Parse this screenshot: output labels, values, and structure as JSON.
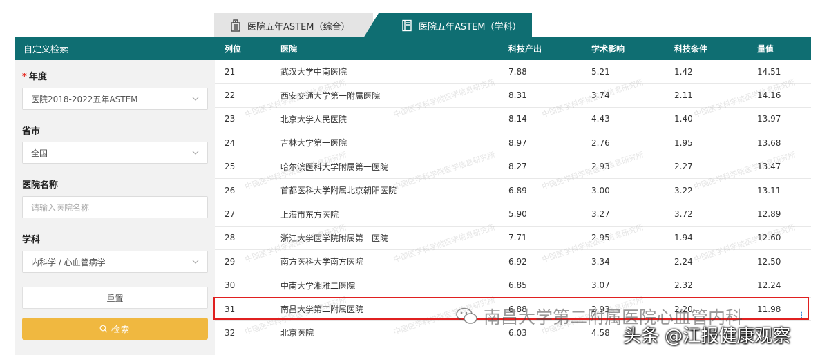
{
  "tabs": [
    {
      "label": "医院五年ASTEM（综合）",
      "icon": "hospital-building-icon"
    },
    {
      "label": "医院五年ASTEM（学科）",
      "icon": "book-icon",
      "active": true
    }
  ],
  "sidebar": {
    "header": "自定义检索",
    "year": {
      "label": "年度",
      "value": "医院2018-2022五年ASTEM"
    },
    "province": {
      "label": "省市",
      "value": "全国"
    },
    "hospital_name": {
      "label": "医院名称",
      "placeholder": "请输入医院名称"
    },
    "subject": {
      "label": "学科",
      "value": "内科学 / 心血管病学"
    },
    "reset_label": "重置",
    "search_label": "检索"
  },
  "table": {
    "columns": [
      "列位",
      "医院",
      "科技产出",
      "学术影响",
      "科技条件",
      "量值"
    ],
    "rows": [
      [
        "21",
        "武汉大学中南医院",
        "7.88",
        "5.21",
        "1.42",
        "14.51"
      ],
      [
        "22",
        "西安交通大学第一附属医院",
        "8.31",
        "3.74",
        "2.11",
        "14.16"
      ],
      [
        "23",
        "北京大学人民医院",
        "8.14",
        "4.43",
        "1.40",
        "13.97"
      ],
      [
        "24",
        "吉林大学第一医院",
        "8.97",
        "2.76",
        "1.95",
        "13.68"
      ],
      [
        "25",
        "哈尔滨医科大学附属第一医院",
        "8.27",
        "2.93",
        "2.27",
        "13.47"
      ],
      [
        "26",
        "首都医科大学附属北京朝阳医院",
        "6.89",
        "3.00",
        "3.22",
        "13.11"
      ],
      [
        "27",
        "上海市东方医院",
        "5.90",
        "3.27",
        "3.72",
        "12.89"
      ],
      [
        "28",
        "浙江大学医学院附属第一医院",
        "7.71",
        "2.95",
        "1.94",
        "12.60"
      ],
      [
        "29",
        "南方医科大学南方医院",
        "6.92",
        "3.34",
        "2.24",
        "12.50"
      ],
      [
        "30",
        "中南大学湘雅二医院",
        "6.85",
        "3.07",
        "2.32",
        "12.24"
      ],
      [
        "31",
        "南昌大学第二附属医院",
        "6.88",
        "2.93",
        "2.20",
        "11.98"
      ],
      [
        "32",
        "北京医院",
        "6.03",
        "4.58",
        "",
        ""
      ]
    ]
  },
  "watermark_text": "中国医学科学院医学信息研究所",
  "overlay": {
    "line1": "南昌大学第二附属医院心血管内科",
    "line2": "头条 @江报健康观察"
  },
  "colors": {
    "primary": "#0f6e72",
    "accent": "#f0b840",
    "highlight": "#e02020"
  }
}
